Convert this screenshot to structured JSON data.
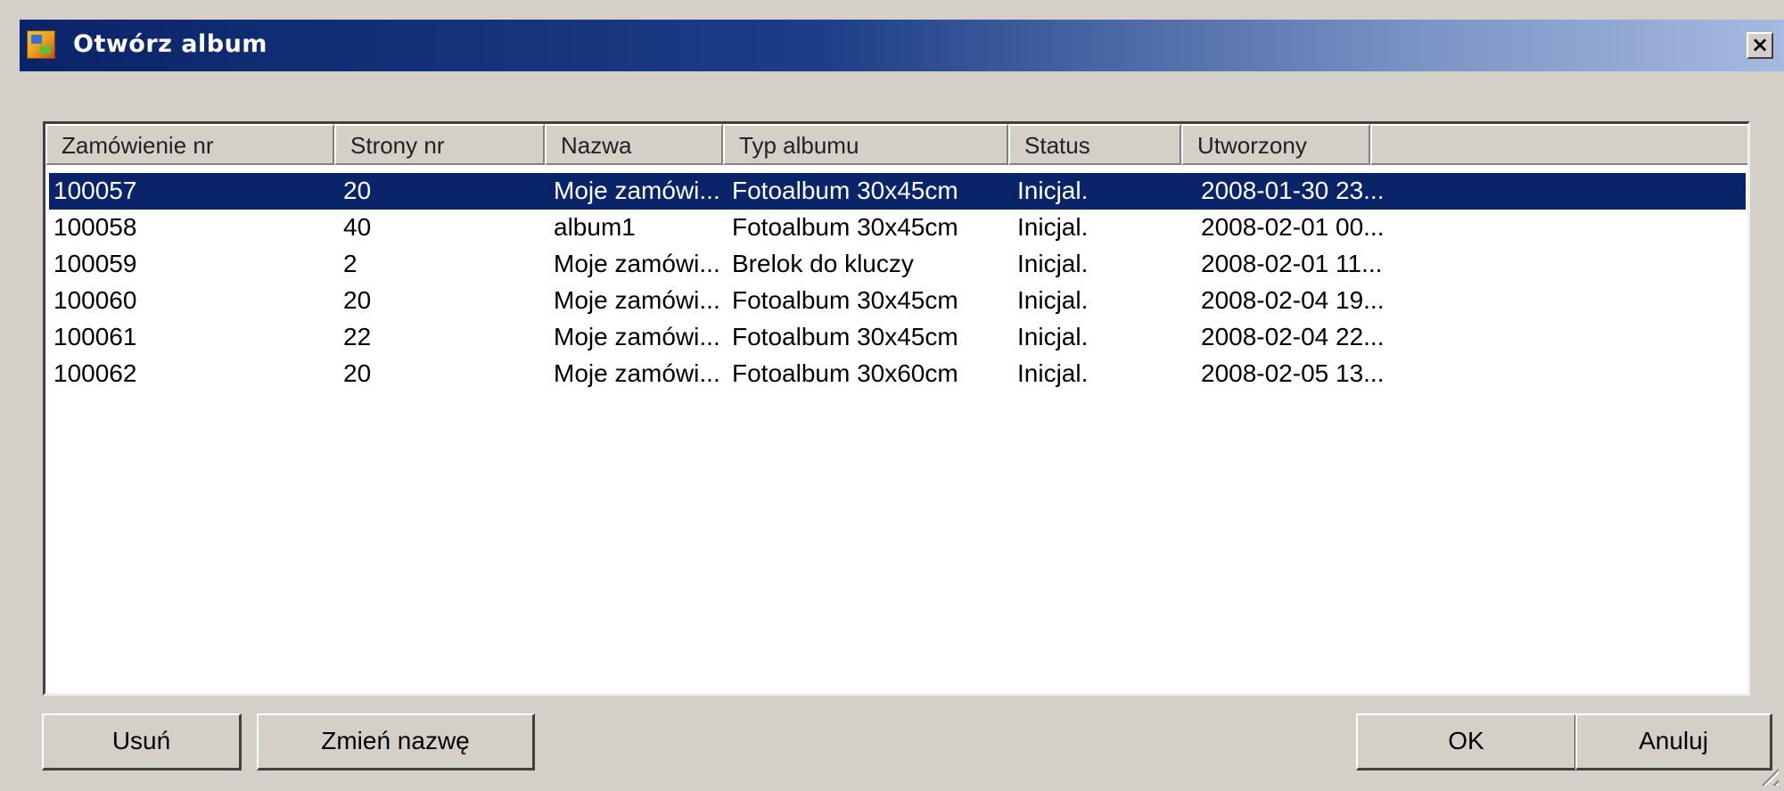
{
  "window": {
    "title": "Otwórz album",
    "close_label": "×"
  },
  "list": {
    "columns": [
      "Zamówienie nr",
      "Strony nr",
      "Nazwa",
      "Typ albumu",
      "Status",
      "Utworzony"
    ],
    "rows": [
      [
        "100057",
        "20",
        "Moje zamówi...",
        "Fotoalbum 30x45cm",
        "Inicjal.",
        "2008-01-30 23..."
      ],
      [
        "100058",
        "40",
        "album1",
        "Fotoalbum 30x45cm",
        "Inicjal.",
        "2008-02-01 00..."
      ],
      [
        "100059",
        "2",
        "Moje zamówi...",
        "Brelok do kluczy",
        "Inicjal.",
        "2008-02-01 11..."
      ],
      [
        "100060",
        "20",
        "Moje zamówi...",
        "Fotoalbum 30x45cm",
        "Inicjal.",
        "2008-02-04 19..."
      ],
      [
        "100061",
        "22",
        "Moje zamówi...",
        "Fotoalbum 30x45cm",
        "Inicjal.",
        "2008-02-04 22..."
      ],
      [
        "100062",
        "20",
        "Moje zamówi...",
        "Fotoalbum 30x60cm",
        "Inicjal.",
        "2008-02-05 13..."
      ]
    ],
    "selected_row": 0
  },
  "buttons": {
    "delete": "Usuń",
    "rename": "Zmień nazwę",
    "ok": "OK",
    "cancel": "Anuluj"
  },
  "colors": {
    "selection": "#0a246a",
    "face": "#d4d0c8"
  }
}
